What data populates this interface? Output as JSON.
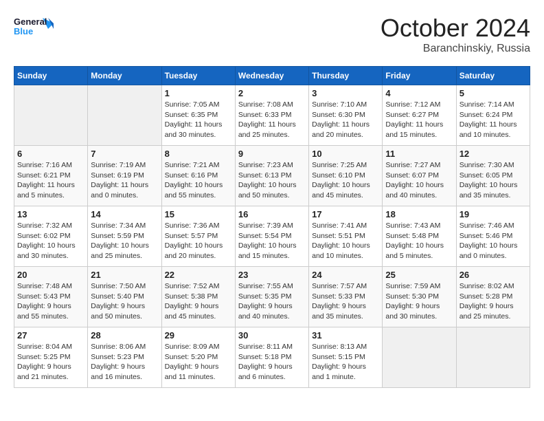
{
  "header": {
    "logo_line1": "General",
    "logo_line2": "Blue",
    "month": "October 2024",
    "location": "Baranchinskiy, Russia"
  },
  "weekdays": [
    "Sunday",
    "Monday",
    "Tuesday",
    "Wednesday",
    "Thursday",
    "Friday",
    "Saturday"
  ],
  "weeks": [
    [
      {
        "day": "",
        "info": ""
      },
      {
        "day": "",
        "info": ""
      },
      {
        "day": "1",
        "info": "Sunrise: 7:05 AM\nSunset: 6:35 PM\nDaylight: 11 hours\nand 30 minutes."
      },
      {
        "day": "2",
        "info": "Sunrise: 7:08 AM\nSunset: 6:33 PM\nDaylight: 11 hours\nand 25 minutes."
      },
      {
        "day": "3",
        "info": "Sunrise: 7:10 AM\nSunset: 6:30 PM\nDaylight: 11 hours\nand 20 minutes."
      },
      {
        "day": "4",
        "info": "Sunrise: 7:12 AM\nSunset: 6:27 PM\nDaylight: 11 hours\nand 15 minutes."
      },
      {
        "day": "5",
        "info": "Sunrise: 7:14 AM\nSunset: 6:24 PM\nDaylight: 11 hours\nand 10 minutes."
      }
    ],
    [
      {
        "day": "6",
        "info": "Sunrise: 7:16 AM\nSunset: 6:21 PM\nDaylight: 11 hours\nand 5 minutes."
      },
      {
        "day": "7",
        "info": "Sunrise: 7:19 AM\nSunset: 6:19 PM\nDaylight: 11 hours\nand 0 minutes."
      },
      {
        "day": "8",
        "info": "Sunrise: 7:21 AM\nSunset: 6:16 PM\nDaylight: 10 hours\nand 55 minutes."
      },
      {
        "day": "9",
        "info": "Sunrise: 7:23 AM\nSunset: 6:13 PM\nDaylight: 10 hours\nand 50 minutes."
      },
      {
        "day": "10",
        "info": "Sunrise: 7:25 AM\nSunset: 6:10 PM\nDaylight: 10 hours\nand 45 minutes."
      },
      {
        "day": "11",
        "info": "Sunrise: 7:27 AM\nSunset: 6:07 PM\nDaylight: 10 hours\nand 40 minutes."
      },
      {
        "day": "12",
        "info": "Sunrise: 7:30 AM\nSunset: 6:05 PM\nDaylight: 10 hours\nand 35 minutes."
      }
    ],
    [
      {
        "day": "13",
        "info": "Sunrise: 7:32 AM\nSunset: 6:02 PM\nDaylight: 10 hours\nand 30 minutes."
      },
      {
        "day": "14",
        "info": "Sunrise: 7:34 AM\nSunset: 5:59 PM\nDaylight: 10 hours\nand 25 minutes."
      },
      {
        "day": "15",
        "info": "Sunrise: 7:36 AM\nSunset: 5:57 PM\nDaylight: 10 hours\nand 20 minutes."
      },
      {
        "day": "16",
        "info": "Sunrise: 7:39 AM\nSunset: 5:54 PM\nDaylight: 10 hours\nand 15 minutes."
      },
      {
        "day": "17",
        "info": "Sunrise: 7:41 AM\nSunset: 5:51 PM\nDaylight: 10 hours\nand 10 minutes."
      },
      {
        "day": "18",
        "info": "Sunrise: 7:43 AM\nSunset: 5:48 PM\nDaylight: 10 hours\nand 5 minutes."
      },
      {
        "day": "19",
        "info": "Sunrise: 7:46 AM\nSunset: 5:46 PM\nDaylight: 10 hours\nand 0 minutes."
      }
    ],
    [
      {
        "day": "20",
        "info": "Sunrise: 7:48 AM\nSunset: 5:43 PM\nDaylight: 9 hours\nand 55 minutes."
      },
      {
        "day": "21",
        "info": "Sunrise: 7:50 AM\nSunset: 5:40 PM\nDaylight: 9 hours\nand 50 minutes."
      },
      {
        "day": "22",
        "info": "Sunrise: 7:52 AM\nSunset: 5:38 PM\nDaylight: 9 hours\nand 45 minutes."
      },
      {
        "day": "23",
        "info": "Sunrise: 7:55 AM\nSunset: 5:35 PM\nDaylight: 9 hours\nand 40 minutes."
      },
      {
        "day": "24",
        "info": "Sunrise: 7:57 AM\nSunset: 5:33 PM\nDaylight: 9 hours\nand 35 minutes."
      },
      {
        "day": "25",
        "info": "Sunrise: 7:59 AM\nSunset: 5:30 PM\nDaylight: 9 hours\nand 30 minutes."
      },
      {
        "day": "26",
        "info": "Sunrise: 8:02 AM\nSunset: 5:28 PM\nDaylight: 9 hours\nand 25 minutes."
      }
    ],
    [
      {
        "day": "27",
        "info": "Sunrise: 8:04 AM\nSunset: 5:25 PM\nDaylight: 9 hours\nand 21 minutes."
      },
      {
        "day": "28",
        "info": "Sunrise: 8:06 AM\nSunset: 5:23 PM\nDaylight: 9 hours\nand 16 minutes."
      },
      {
        "day": "29",
        "info": "Sunrise: 8:09 AM\nSunset: 5:20 PM\nDaylight: 9 hours\nand 11 minutes."
      },
      {
        "day": "30",
        "info": "Sunrise: 8:11 AM\nSunset: 5:18 PM\nDaylight: 9 hours\nand 6 minutes."
      },
      {
        "day": "31",
        "info": "Sunrise: 8:13 AM\nSunset: 5:15 PM\nDaylight: 9 hours\nand 1 minute."
      },
      {
        "day": "",
        "info": ""
      },
      {
        "day": "",
        "info": ""
      }
    ]
  ]
}
